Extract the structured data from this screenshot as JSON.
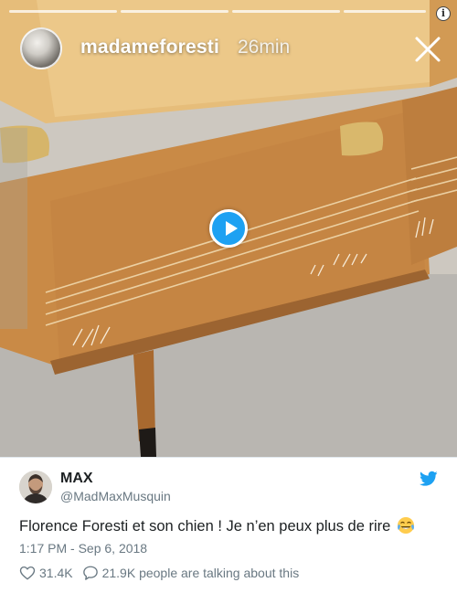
{
  "story": {
    "username": "madameforesti",
    "time": "26min"
  },
  "tweet": {
    "author_name": "MAX",
    "author_handle": "@MadMaxMusquin",
    "text": "Florence Foresti et son chien ! Je n’en peux plus de rire",
    "emoji": "face-with-tears-of-joy",
    "timestamp": "1:17 PM - Sep 6, 2018",
    "likes": "31.4K",
    "talking": "21.9K people are talking about this"
  },
  "colors": {
    "brand": "#1da1f2",
    "secondary_text": "#697882",
    "primary_text": "#1c2022"
  }
}
